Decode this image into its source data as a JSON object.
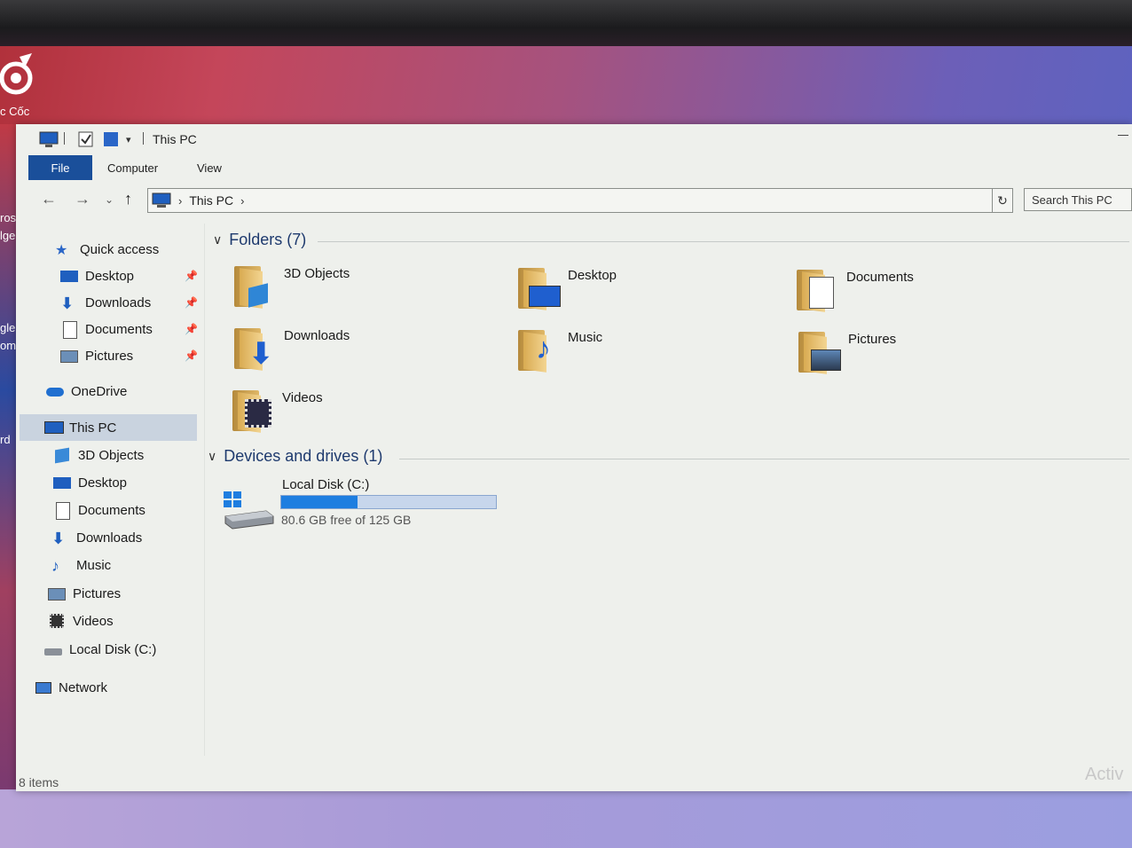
{
  "desktop": {
    "coccoc_label": "c Cốc",
    "left_labels": [
      "rosc",
      "lge",
      "gle",
      "om",
      "rd"
    ]
  },
  "window": {
    "title": "This PC",
    "ribbon": {
      "file": "File",
      "computer": "Computer",
      "view": "View"
    },
    "address": {
      "location": "This PC",
      "search_placeholder": "Search This PC"
    },
    "nav": {
      "quick_access": "Quick access",
      "quick_items": [
        "Desktop",
        "Downloads",
        "Documents",
        "Pictures"
      ],
      "onedrive": "OneDrive",
      "this_pc": "This PC",
      "pc_items": [
        "3D Objects",
        "Desktop",
        "Documents",
        "Downloads",
        "Music",
        "Pictures",
        "Videos",
        "Local Disk (C:)"
      ],
      "network": "Network"
    },
    "folders_header": "Folders (7)",
    "folders": [
      "3D Objects",
      "Desktop",
      "Documents",
      "Downloads",
      "Music",
      "Pictures",
      "Videos"
    ],
    "devices_header": "Devices and drives (1)",
    "drive": {
      "name": "Local Disk (C:)",
      "free_text": "80.6 GB free of 125 GB",
      "used_fraction": 0.355
    },
    "status": "8 items",
    "activate_watermark": "Activ"
  },
  "colors": {
    "accent": "#1a4f9a",
    "drive_fill": "#1e7ee0",
    "header_text": "#1e3a6e"
  }
}
